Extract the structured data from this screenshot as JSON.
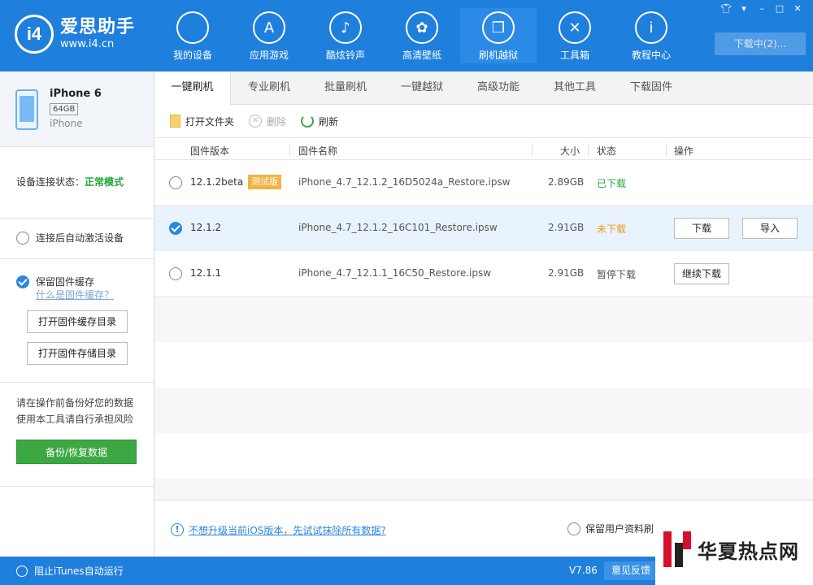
{
  "app": {
    "logo_mark": "i4",
    "name": "爱思助手",
    "url": "www.i4.cn"
  },
  "nav": [
    {
      "label": "我的设备",
      "icon": "apple-icon",
      "glyph": ""
    },
    {
      "label": "应用游戏",
      "icon": "app-store-icon",
      "glyph": "A"
    },
    {
      "label": "酷炫铃声",
      "icon": "bell-icon",
      "glyph": "♪"
    },
    {
      "label": "高清壁纸",
      "icon": "flower-icon",
      "glyph": "✿"
    },
    {
      "label": "刷机越狱",
      "icon": "box-icon",
      "glyph": "❒"
    },
    {
      "label": "工具箱",
      "icon": "tools-icon",
      "glyph": "✕"
    },
    {
      "label": "教程中心",
      "icon": "info-icon",
      "glyph": "i"
    }
  ],
  "nav_active": "刷机越狱",
  "window": {
    "download_status": "下载中(2)..."
  },
  "device": {
    "name": "iPhone 6",
    "capacity": "64GB",
    "model": "iPhone"
  },
  "connection": {
    "label": "设备连接状态：",
    "value": "正常模式"
  },
  "auto_activate": {
    "label": "连接后自动激活设备",
    "checked": false
  },
  "cache": {
    "label": "保留固件缓存",
    "checked": true,
    "help_link": "什么是固件缓存？",
    "open_cache_dir": "打开固件缓存目录",
    "open_storage_dir": "打开固件存储目录"
  },
  "backup": {
    "warning_line1": "请在操作前备份好您的数据",
    "warning_line2": "使用本工具请自行承担风险",
    "button": "备份/恢复数据"
  },
  "tabs": [
    "一键刷机",
    "专业刷机",
    "批量刷机",
    "一键越狱",
    "高级功能",
    "其他工具",
    "下载固件"
  ],
  "active_tab": "一键刷机",
  "toolbar": {
    "open_folder": "打开文件夹",
    "delete": "删除",
    "refresh": "刷新"
  },
  "table": {
    "headers": {
      "version": "固件版本",
      "name": "固件名称",
      "size": "大小",
      "status": "状态",
      "action": "操作"
    },
    "rows": [
      {
        "version": "12.1.2beta",
        "badge": "测试版",
        "name": "iPhone_4.7_12.1.2_16D5024a_Restore.ipsw",
        "size": "2.89GB",
        "status": "已下载",
        "selected": false
      },
      {
        "version": "12.1.2",
        "badge": "",
        "name": "iPhone_4.7_12.1.2_16C101_Restore.ipsw",
        "size": "2.91GB",
        "status": "未下载",
        "selected": true,
        "btn1": "下载",
        "btn2": "导入"
      },
      {
        "version": "12.1.1",
        "badge": "",
        "name": "iPhone_4.7_12.1.1_16C50_Restore.ipsw",
        "size": "2.91GB",
        "status": "暂停下载",
        "selected": false,
        "btn1": "继续下载"
      }
    ]
  },
  "footer": {
    "erase_link": "不想升级当前iOS版本，先试试抹除所有数据?",
    "keep_data": "保留用户资料刷"
  },
  "statusbar": {
    "itunes": "阻止iTunes自动运行",
    "version": "V7.86",
    "feedback": "意见反馈"
  },
  "watermark": {
    "text": "华夏热点网"
  },
  "colors": {
    "brand": "#1f7fdc",
    "ok": "#23a53a",
    "warn": "#f09a1a",
    "beta": "#f4b340",
    "action": "#3ca843"
  }
}
